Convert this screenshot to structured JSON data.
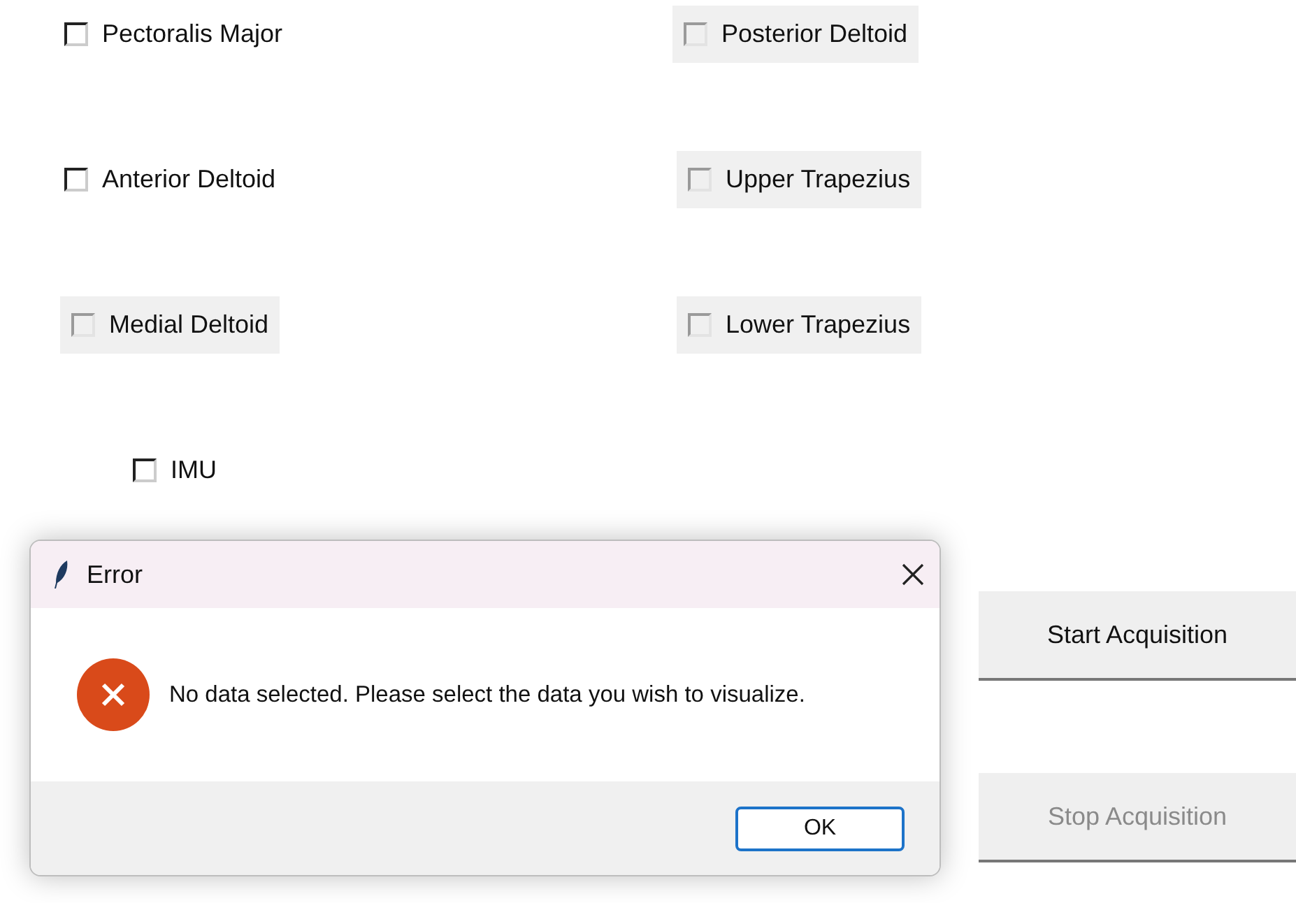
{
  "left_column": [
    {
      "label": "Pectoralis Major",
      "checked": false,
      "highlighted": false
    },
    {
      "label": "Anterior Deltoid",
      "checked": false,
      "highlighted": false
    },
    {
      "label": "Medial Deltoid",
      "checked": false,
      "highlighted": true
    }
  ],
  "right_column": [
    {
      "label": "Posterior Deltoid",
      "checked": false,
      "highlighted": true
    },
    {
      "label": "Upper Trapezius",
      "checked": false,
      "highlighted": true
    },
    {
      "label": "Lower Trapezius",
      "checked": false,
      "highlighted": true
    }
  ],
  "imu": {
    "label": "IMU",
    "checked": false,
    "highlighted": false
  },
  "buttons": [
    {
      "label": "Start Acquisition",
      "disabled": false
    },
    {
      "label": "Stop Acquisition",
      "disabled": true
    }
  ],
  "dialog": {
    "title": "Error",
    "message": "No data selected. Please select the data you wish to visualize.",
    "button": "OK"
  }
}
